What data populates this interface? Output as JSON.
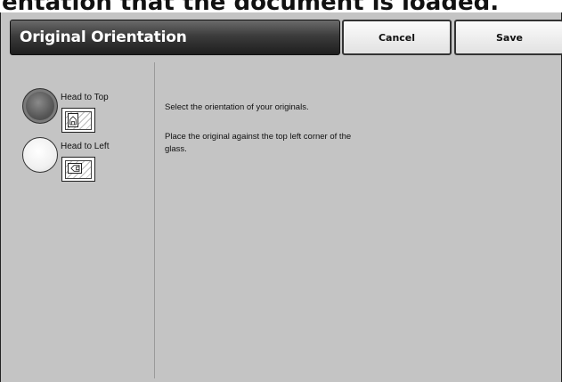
{
  "caption": "entation that the document is loaded.",
  "header": {
    "title": "Original Orientation",
    "cancel_label": "Cancel",
    "save_label": "Save"
  },
  "options": [
    {
      "label": "Head to Top",
      "selected": true,
      "icon": "head-to-top-icon"
    },
    {
      "label": "Head to Left",
      "selected": false,
      "icon": "head-to-left-icon"
    }
  ],
  "description": {
    "line1": "Select the orientation of your originals.",
    "line2": "Place the original against the top left corner of the glass."
  }
}
